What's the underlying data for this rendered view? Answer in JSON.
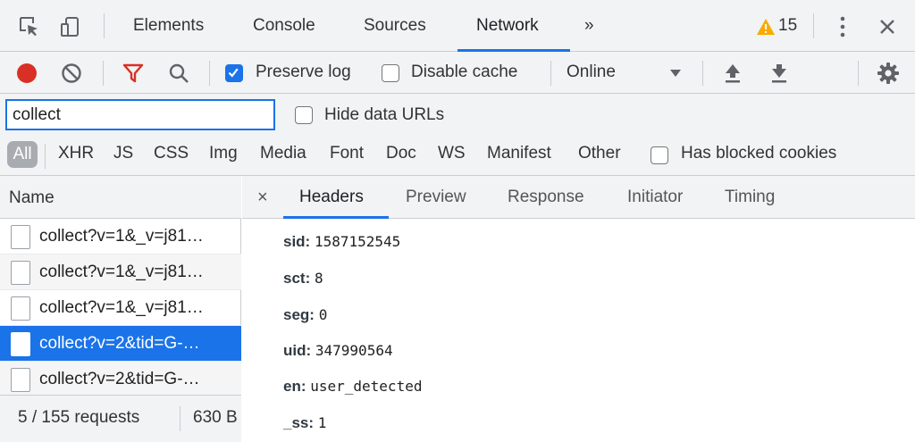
{
  "devtools": {
    "tabs": [
      "Elements",
      "Console",
      "Sources",
      "Network",
      "»"
    ],
    "active_tab": "Network",
    "warnings_count": "15",
    "menu_icon": "kebab-menu-icon",
    "close_icon": "close-icon"
  },
  "toolbar": {
    "preserve_log_label": "Preserve log",
    "preserve_log_checked": true,
    "disable_cache_label": "Disable cache",
    "disable_cache_checked": false,
    "throttle_value": "Online"
  },
  "filter": {
    "value": "collect",
    "hide_data_urls_label": "Hide data URLs"
  },
  "types": {
    "all": "All",
    "items": [
      "XHR",
      "JS",
      "CSS",
      "Img",
      "Media",
      "Font",
      "Doc",
      "WS",
      "Manifest",
      "Other"
    ],
    "blocked_cookies_label": "Has blocked cookies"
  },
  "requests": {
    "header": "Name",
    "rows": [
      "collect?v=1&_v=j81…",
      "collect?v=1&_v=j81…",
      "collect?v=1&_v=j81…",
      "collect?v=2&tid=G-…",
      "collect?v=2&tid=G-…"
    ],
    "selected_index": 3,
    "status_count": "5 / 155 requests",
    "status_size": "630 B"
  },
  "detail": {
    "close": "×",
    "tabs": [
      "Headers",
      "Preview",
      "Response",
      "Initiator",
      "Timing"
    ],
    "active_tab": "Headers",
    "params": [
      {
        "k": "sid:",
        "v": "1587152545"
      },
      {
        "k": "sct:",
        "v": "8"
      },
      {
        "k": "seg:",
        "v": "0"
      },
      {
        "k": "uid:",
        "v": "347990564"
      },
      {
        "k": "en:",
        "v": "user_detected"
      },
      {
        "k": "_ss:",
        "v": "1"
      }
    ]
  },
  "colors": {
    "accent": "#1a73e8",
    "record": "#d93025",
    "filter_active": "#d93025",
    "warning": "#f9ab00"
  }
}
